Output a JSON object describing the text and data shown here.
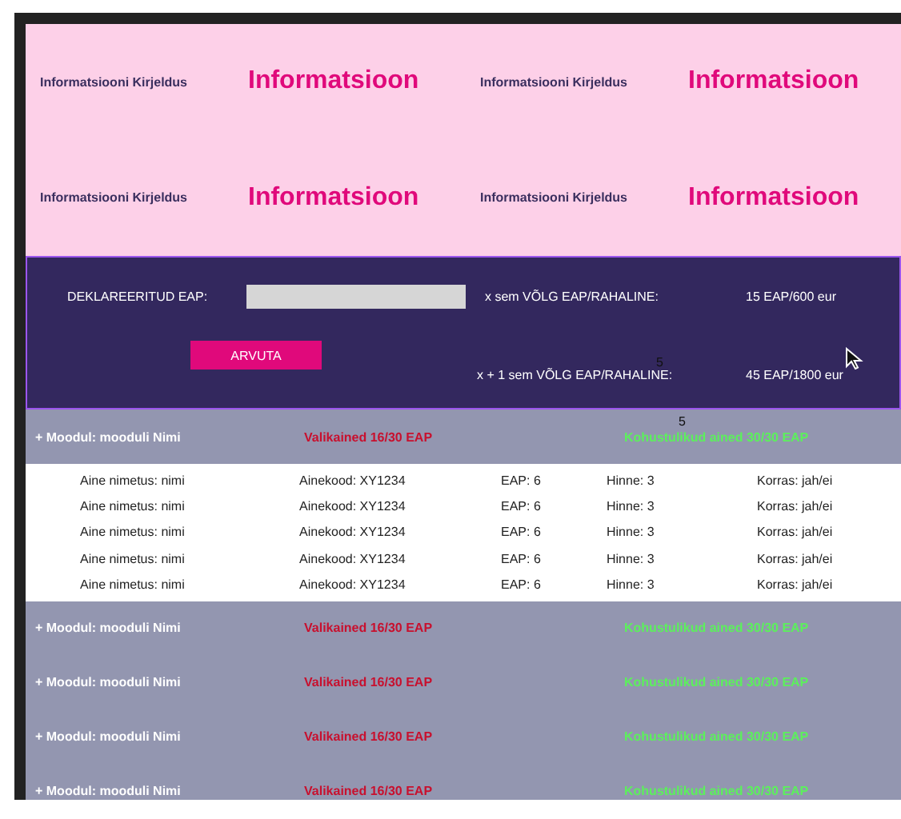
{
  "info_grid": [
    {
      "kind": "caption",
      "text": "Informatsiooni Kirjeldus"
    },
    {
      "kind": "heading",
      "text": "Informatsioon"
    },
    {
      "kind": "caption",
      "text": "Informatsiooni Kirjeldus"
    },
    {
      "kind": "heading",
      "text": "Informatsioon"
    },
    {
      "kind": "caption",
      "text": "Informatsiooni Kirjeldus"
    },
    {
      "kind": "heading",
      "text": "Informatsioon"
    },
    {
      "kind": "caption",
      "text": "Informatsiooni Kirjeldus"
    },
    {
      "kind": "heading",
      "text": "Informatsioon"
    }
  ],
  "calculator": {
    "declared_label": "DEKLAREERITUD EAP:",
    "button": "ARVUTA",
    "results": [
      {
        "label": "x sem VÕLG EAP/RAHALINE:",
        "value": "15 EAP/600 eur"
      },
      {
        "label": "x + 1 sem VÕLG EAP/RAHALINE:",
        "value": "45 EAP/1800 eur"
      }
    ],
    "stray_mark": "5"
  },
  "modules": [
    {
      "title": "+ Moodul: mooduli Nimi",
      "elective": "Valikained 16/30 EAP",
      "mandatory": "Kohustulikud ained 30/30 EAP",
      "expanded": true,
      "stray_mark": "5",
      "courses": [
        {
          "name": "Aine nimetus: nimi",
          "code": "Ainekood: XY1234",
          "credits": "EAP: 6",
          "grade": "Hinne: 3",
          "status": "Korras: jah/ei"
        },
        {
          "name": "Aine nimetus: nimi",
          "code": "Ainekood: XY1234",
          "credits": "EAP: 6",
          "grade": "Hinne: 3",
          "status": "Korras: jah/ei"
        },
        {
          "name": "Aine nimetus: nimi",
          "code": "Ainekood: XY1234",
          "credits": "EAP: 6",
          "grade": "Hinne: 3",
          "status": "Korras: jah/ei"
        },
        {
          "name": "Aine nimetus: nimi",
          "code": "Ainekood: XY1234",
          "credits": "EAP: 6",
          "grade": "Hinne: 3",
          "status": "Korras: jah/ei"
        },
        {
          "name": "Aine nimetus: nimi",
          "code": "Ainekood: XY1234",
          "credits": "EAP: 6",
          "grade": "Hinne: 3",
          "status": "Korras: jah/ei"
        }
      ]
    },
    {
      "title": "+ Moodul: mooduli Nimi",
      "elective": "Valikained 16/30 EAP",
      "mandatory": "Kohustulikud ained 30/30 EAP",
      "expanded": false
    },
    {
      "title": "+ Moodul: mooduli Nimi",
      "elective": "Valikained 16/30 EAP",
      "mandatory": "Kohustulikud ained 30/30 EAP",
      "expanded": false
    },
    {
      "title": "+ Moodul: mooduli Nimi",
      "elective": "Valikained 16/30 EAP",
      "mandatory": "Kohustulikud ained 30/30 EAP",
      "expanded": false
    },
    {
      "title": "+ Moodul: mooduli Nimi",
      "elective": "Valikained 16/30 EAP",
      "mandatory": "Kohustulikud ained 30/30 EAP",
      "expanded": false
    }
  ]
}
